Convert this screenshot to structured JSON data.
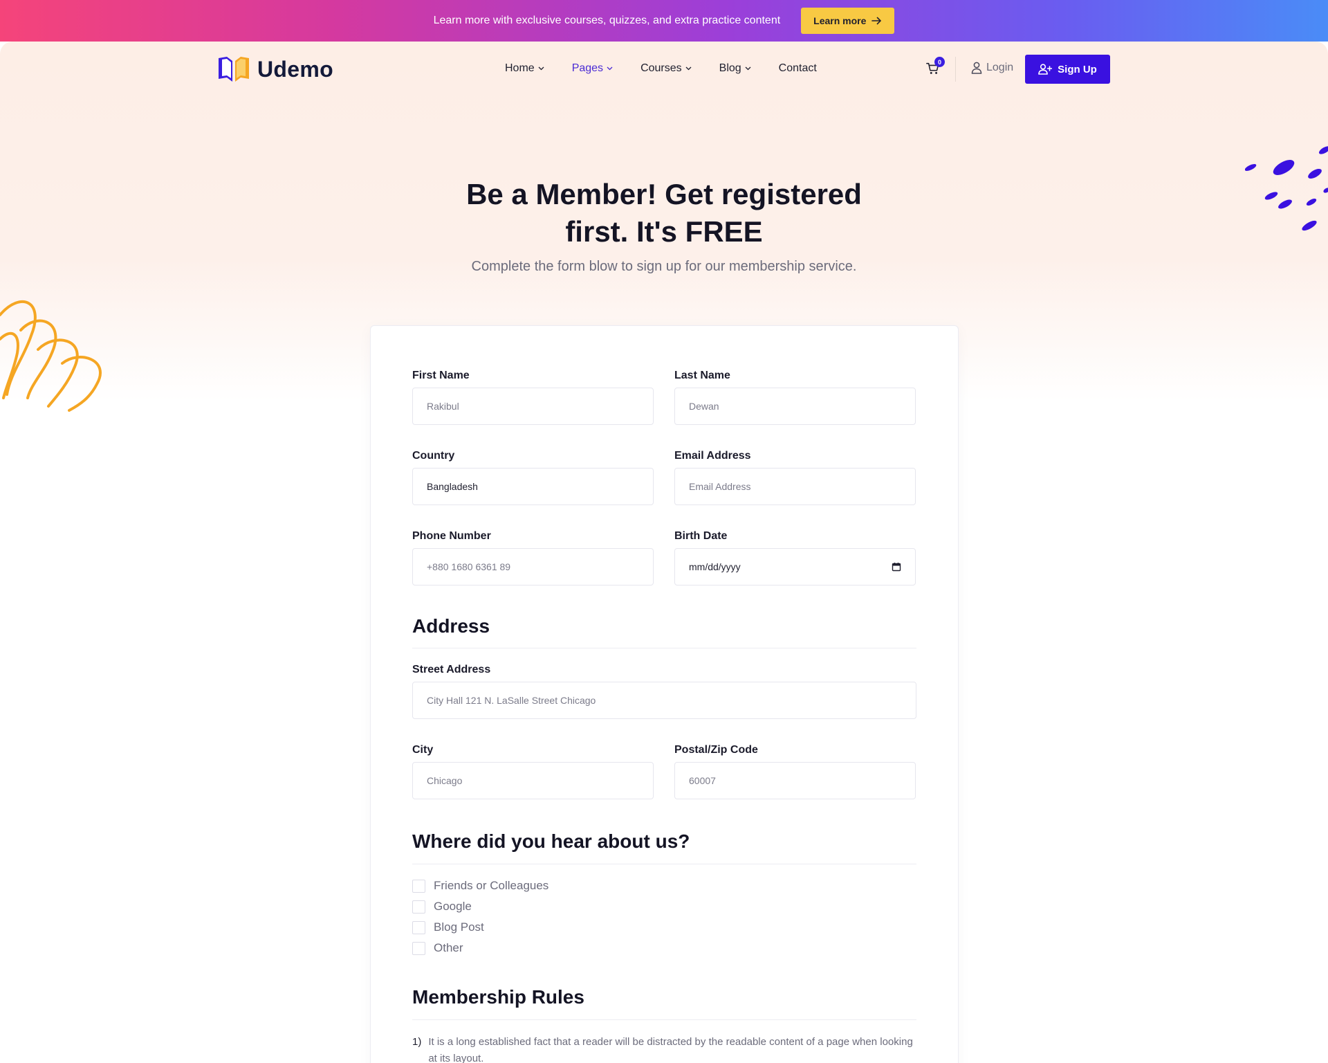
{
  "promo": {
    "text": "Learn more with exclusive courses, quizzes, and extra practice content",
    "button_label": "Learn more",
    "gradient_colors": [
      "#f5447a",
      "#9b3fd9",
      "#4a8cf7"
    ],
    "button_color": "#f8c943"
  },
  "header": {
    "brand": "Udemo",
    "nav": [
      {
        "label": "Home",
        "has_dropdown": true
      },
      {
        "label": "Pages",
        "has_dropdown": true,
        "active": true
      },
      {
        "label": "Courses",
        "has_dropdown": true
      },
      {
        "label": "Blog",
        "has_dropdown": true
      },
      {
        "label": "Contact",
        "has_dropdown": false
      }
    ],
    "cart_count": "0",
    "login_label": "Login",
    "signup_label": "Sign Up",
    "accent_color": "#3a11e0"
  },
  "hero": {
    "title": "Be a Member! Get registered first. It's FREE",
    "subtitle": "Complete the form blow to sign up for our membership service."
  },
  "form": {
    "first_name": {
      "label": "First Name",
      "placeholder": "Rakibul"
    },
    "last_name": {
      "label": "Last Name",
      "placeholder": "Dewan"
    },
    "country": {
      "label": "Country",
      "value": "Bangladesh"
    },
    "email": {
      "label": "Email Address",
      "placeholder": "Email Address"
    },
    "phone": {
      "label": "Phone Number",
      "placeholder": "+880 1680 6361 89"
    },
    "birth_date": {
      "label": "Birth Date",
      "value": "mm/dd/yyyy"
    },
    "address_title": "Address",
    "street": {
      "label": "Street Address",
      "placeholder": "City Hall 121 N. LaSalle Street Chicago"
    },
    "city": {
      "label": "City",
      "placeholder": "Chicago"
    },
    "postal": {
      "label": "Postal/Zip Code",
      "placeholder": "60007"
    },
    "hear_title": "Where did you hear about us?",
    "hear_options": [
      "Friends or Colleagues",
      "Google",
      "Blog Post",
      "Other"
    ],
    "rules_title": "Membership Rules",
    "rules": [
      {
        "num": "1)",
        "text": "It is a long established fact that a reader will be distracted by the readable content of a page when looking at its layout."
      }
    ]
  }
}
